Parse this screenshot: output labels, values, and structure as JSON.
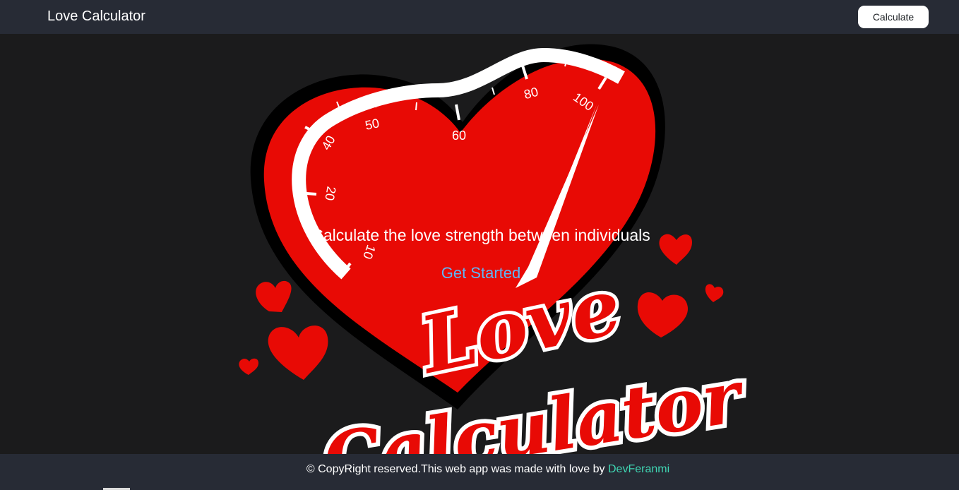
{
  "navbar": {
    "brand": "Love Calculator",
    "button_label": "Calculate"
  },
  "hero": {
    "tagline": "Calculate the love strength between individuals",
    "cta_label": "Get Started",
    "gauge_ticks": [
      "10",
      "20",
      "40",
      "50",
      "60",
      "80",
      "100"
    ],
    "logo_words": [
      "Love",
      "Calculator"
    ]
  },
  "footer": {
    "text": "© CopyRight reserved.This web app was made with love by",
    "author_link": "DevFeranmi"
  },
  "colors": {
    "navbar_bg": "#272b35",
    "page_bg": "#1b1b1c",
    "heart_red": "#e80a05",
    "link_blue": "#5fb6f5",
    "author_teal": "#3fd7b4"
  },
  "icons": {
    "heart": "heart-icon"
  }
}
